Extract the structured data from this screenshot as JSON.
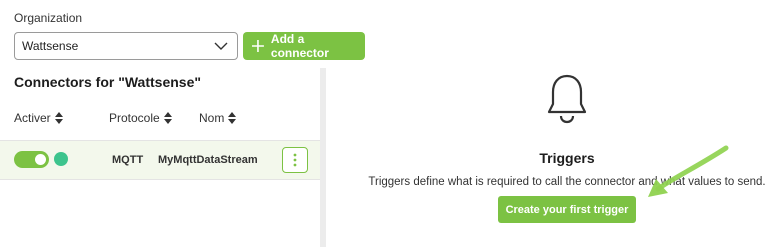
{
  "organization": {
    "label": "Organization",
    "selected": "Wattsense"
  },
  "add_connector_label": "Add a connector",
  "connectors": {
    "title": "Connectors for \"Wattsense\"",
    "columns": [
      "Activer",
      "Protocole",
      "Nom"
    ],
    "rows": [
      {
        "active": true,
        "status_color": "#3cc48d",
        "protocol": "MQTT",
        "name": "MyMqttDataStream"
      }
    ]
  },
  "triggers": {
    "title": "Triggers",
    "description": "Triggers define what is required to call the connector and what values to send.",
    "create_label": "Create your first trigger"
  },
  "colors": {
    "accent": "#7cc243",
    "status_ok": "#3cc48d"
  },
  "icons": [
    "chevron-down-icon",
    "plus-icon",
    "sort-icon",
    "more-vertical-icon",
    "bell-icon",
    "arrow-annotation"
  ]
}
